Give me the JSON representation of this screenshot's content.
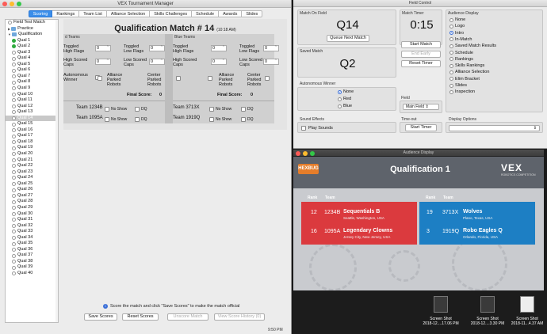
{
  "tm": {
    "title": "VEX Tournament Manager",
    "tabs": [
      "Scoring",
      "Rankings",
      "Team List",
      "Alliance Selection",
      "Skills Challenges",
      "Schedule",
      "Awards",
      "Slides"
    ],
    "tree": {
      "field_test": "Field Test Match",
      "practice": "Practice",
      "qualification": "Qualification",
      "quals": [
        "Qual 1",
        "Qual 2",
        "Qual 3",
        "Qual 4",
        "Qual 5",
        "Qual 6",
        "Qual 7",
        "Qual 8",
        "Qual 9",
        "Qual 10",
        "Qual 11",
        "Qual 12",
        "Qual 13",
        "Qual 14",
        "Qual 15",
        "Qual 16",
        "Qual 17",
        "Qual 18",
        "Qual 19",
        "Qual 20",
        "Qual 21",
        "Qual 22",
        "Qual 23",
        "Qual 24",
        "Qual 25",
        "Qual 26",
        "Qual 27",
        "Qual 28",
        "Qual 29",
        "Qual 30",
        "Qual 31",
        "Qual 32",
        "Qual 33",
        "Qual 34",
        "Qual 35",
        "Qual 36",
        "Qual 37",
        "Qual 38",
        "Qual 39",
        "Qual 40"
      ],
      "completed": [
        "Qual 1",
        "Qual 2"
      ],
      "selected": "Qual 14"
    },
    "score": {
      "title": "Qualification Match # 14",
      "time": "(10:18 AM)",
      "red_label": "d Teams",
      "blue_label": "Blue Teams",
      "fields": {
        "high_flags": "High Flags",
        "toggled": "Toggled",
        "low_flags": "Low Flags",
        "high_scored_caps": "High Scored Caps",
        "low_scored_caps": "Low Scored Caps",
        "autonomous_winner": "Autonomous Winner",
        "alliance_parked": "Alliance Parked Robots",
        "center_parked": "Center Parked Robots",
        "final_score": "Final Score:"
      },
      "red": {
        "toggled_high": "0",
        "toggled_low": "0",
        "high_caps": "0",
        "low_caps": "0",
        "final": "0",
        "teams": [
          "Team 1234B",
          "Team 1095A"
        ]
      },
      "blue": {
        "toggled_high": "0",
        "toggled_low": "0",
        "high_caps": "0",
        "low_caps": "0",
        "final": "0",
        "teams": [
          "Team 3713X",
          "Team 1919Q"
        ]
      },
      "no_show": "No Show",
      "dq": "DQ"
    },
    "hint": "Score the match and click \"Save Scores\" to make the match official",
    "buttons": {
      "save": "Save Scores",
      "reset": "Reset Scores",
      "unscore": "Unscore Match",
      "history": "View Score History (0)"
    },
    "clock": "9:50 PM"
  },
  "fc": {
    "title": "Field Control",
    "match_on_field_label": "Match On Field",
    "match_on_field": "Q14",
    "queue_next": "Queue Next Match",
    "match_timer_label": "Match Timer",
    "timer": "0:15",
    "start": "Start Match",
    "end_early": "End Early",
    "reset_timer": "Reset Timer",
    "saved_match_label": "Saved Match",
    "saved_match": "Q2",
    "auto_winner_label": "Autonomous Winner",
    "auto_options": [
      "None",
      "Red",
      "Blue"
    ],
    "field_label": "Field",
    "field_value": "Main Field",
    "sound_label": "Sound Effects",
    "play_sounds": "Play Sounds",
    "timeout_label": "Time-out",
    "start_timer": "Start Timer",
    "audience_label": "Audience Display",
    "audience_options": [
      "None",
      "Logo",
      "Intro",
      "In-Match",
      "Saved Match Results",
      "Schedule",
      "Rankings",
      "Skills Rankings",
      "Alliance Selection",
      "Elim Bracket",
      "Slides",
      "Inspection"
    ],
    "audience_selected": "Intro",
    "display_options_label": "Display Options"
  },
  "ad": {
    "title": "Audience Display",
    "logo": "HEXBUG",
    "heading": "Qualification 1",
    "vex": "VEX",
    "vex_sub": "ROBOTICS COMPETITION",
    "rank_label": "Rank",
    "team_label": "Team",
    "red": [
      {
        "rank": "12",
        "team": "1234B",
        "name": "Sequentials B",
        "loc": "Seattle, Washington, USA"
      },
      {
        "rank": "16",
        "team": "1095A",
        "name": "Legendary Clowns",
        "loc": "Jersey City, New Jersey, USA"
      }
    ],
    "blue": [
      {
        "rank": "19",
        "team": "3713X",
        "name": "Wolves",
        "loc": "Plano, Texas, USA"
      },
      {
        "rank": "3",
        "team": "1919Q",
        "name": "Robo Eagles Q",
        "loc": "Orlando, Florida, USA"
      }
    ],
    "colors": {
      "red": "#db3a3e",
      "blue": "#1d7fc4",
      "header": "#5e636b"
    }
  },
  "desktop": {
    "files": [
      {
        "label1": "Screen Shot",
        "label2": "2018-12....17.06 PM"
      },
      {
        "label1": "Screen Shot",
        "label2": "2018-12....3.30 PM"
      },
      {
        "label1": "Screen Shot",
        "label2": "2018-11...4.37 AM"
      }
    ]
  }
}
